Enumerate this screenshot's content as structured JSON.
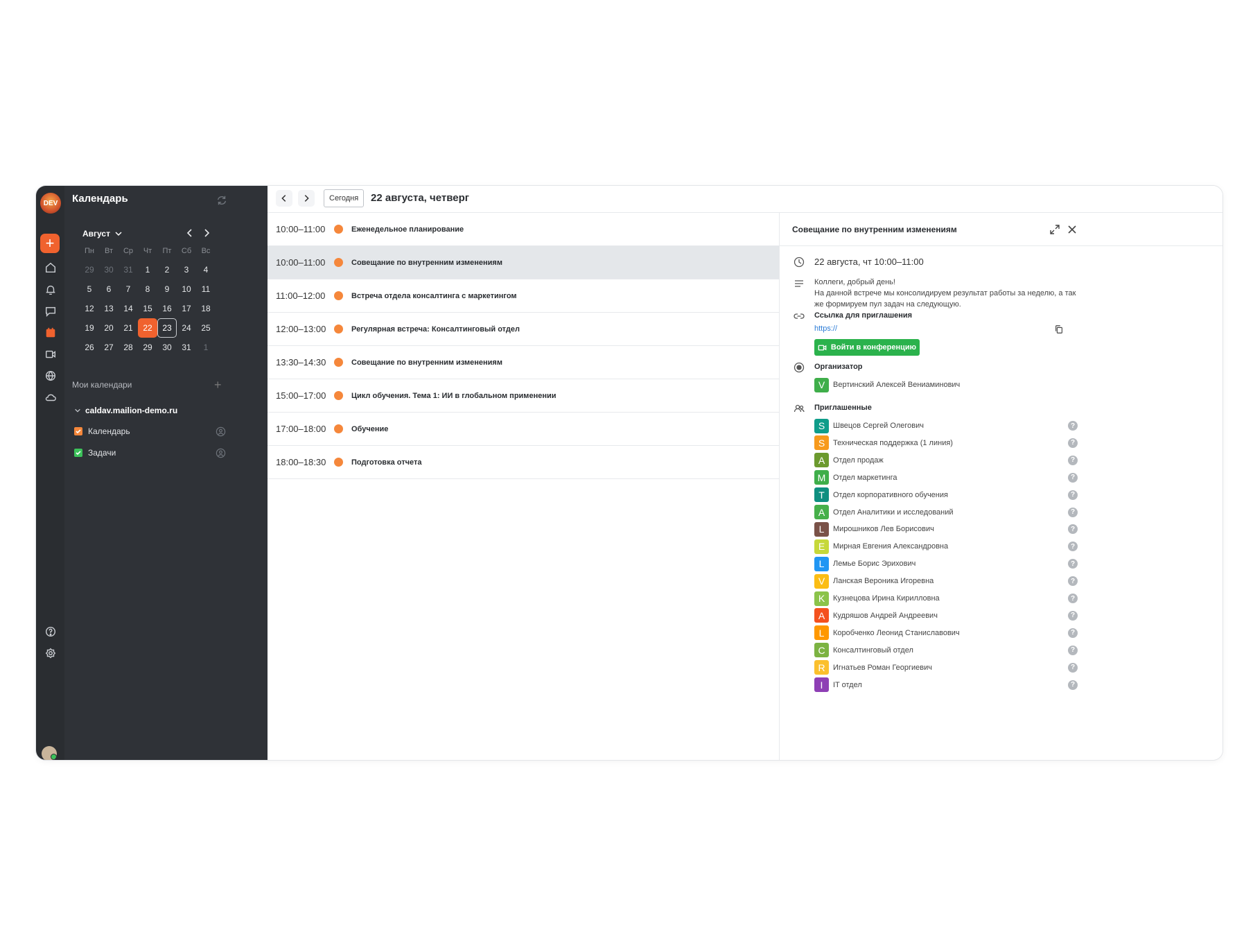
{
  "app": {
    "title": "Календарь",
    "logo_text": "DEV"
  },
  "rail": {
    "items": [
      "home-icon",
      "bell-icon",
      "chat-icon",
      "calendar-icon",
      "video-icon",
      "globe-icon",
      "cloud-icon",
      "help-icon",
      "settings-icon"
    ]
  },
  "mini_calendar": {
    "month": "Август",
    "weekdays": [
      "Пн",
      "Вт",
      "Ср",
      "Чт",
      "Пт",
      "Сб",
      "Вс"
    ],
    "weeks": [
      [
        "29",
        "30",
        "31",
        "1",
        "2",
        "3",
        "4"
      ],
      [
        "5",
        "6",
        "7",
        "8",
        "9",
        "10",
        "11"
      ],
      [
        "12",
        "13",
        "14",
        "15",
        "16",
        "17",
        "18"
      ],
      [
        "19",
        "20",
        "21",
        "22",
        "23",
        "24",
        "25"
      ],
      [
        "26",
        "27",
        "28",
        "29",
        "30",
        "31",
        "1"
      ]
    ],
    "selected": "22",
    "today": "23"
  },
  "my_calendars": {
    "label": "Мои календари",
    "account": "caldav.mailion-demo.ru",
    "items": [
      {
        "label": "Календарь",
        "color": "#f5873b"
      },
      {
        "label": "Задачи",
        "color": "#3cc25a"
      }
    ]
  },
  "toolbar": {
    "today_label": "Сегодня",
    "date_title": "22 августа, четверг"
  },
  "events": [
    {
      "time": "10:00–11:00",
      "title": "Еженедельное планирование"
    },
    {
      "time": "10:00–11:00",
      "title": "Совещание по внутренним изменениям",
      "active": true
    },
    {
      "time": "11:00–12:00",
      "title": "Встреча отдела консалтинга с маркетингом"
    },
    {
      "time": "12:00–13:00",
      "title": "Регулярная встреча: Консалтинговый отдел"
    },
    {
      "time": "13:30–14:30",
      "title": "Совещание по внутренним изменениям"
    },
    {
      "time": "15:00–17:00",
      "title": "Цикл обучения. Тема 1: ИИ в глобальном применении"
    },
    {
      "time": "17:00–18:00",
      "title": "Обучение"
    },
    {
      "time": "18:00–18:30",
      "title": "Подготовка отчета"
    }
  ],
  "event_color": "#f5873b",
  "details": {
    "title": "Совещание по внутренним изменениям",
    "datetime": "22 августа, чт 10:00–11:00",
    "description_lines": [
      "Коллеги, добрый день!",
      "На данной встрече мы консолидируем результат работы за неделю, а так же формируем пул задач на следующую."
    ],
    "invite_link_label": "Ссылка для приглашения",
    "invite_link": "https://",
    "join_button": "Войти в конференцию",
    "organizer_label": "Организатор",
    "organizer": {
      "initial": "V",
      "name": "Вертинский Алексей Вениаминович",
      "color": "#3fae4a"
    },
    "invited_label": "Приглашенные",
    "invited": [
      {
        "initial": "S",
        "name": "Швецов Сергей Олегович",
        "color": "#0f9d8a"
      },
      {
        "initial": "S",
        "name": "Техническая поддержка (1 линия)",
        "color": "#f79a1c"
      },
      {
        "initial": "A",
        "name": "Отдел продаж",
        "color": "#6c9a2e"
      },
      {
        "initial": "M",
        "name": "Отдел маркетинга",
        "color": "#3fae4a"
      },
      {
        "initial": "T",
        "name": "Отдел корпоративного обучения",
        "color": "#0f8f80"
      },
      {
        "initial": "A",
        "name": "Отдел Аналитики и исследований",
        "color": "#46b04a"
      },
      {
        "initial": "L",
        "name": "Мирошников Лев Борисович",
        "color": "#7a5248"
      },
      {
        "initial": "E",
        "name": "Мирная Евгения Александровна",
        "color": "#c6d83a"
      },
      {
        "initial": "L",
        "name": "Лемье Борис Эрихович",
        "color": "#2196f3"
      },
      {
        "initial": "V",
        "name": "Ланская Вероника Игоревна",
        "color": "#fbbd14"
      },
      {
        "initial": "K",
        "name": "Кузнецова Ирина Кирилловна",
        "color": "#8bc34a"
      },
      {
        "initial": "A",
        "name": "Кудряшов Андрей Андреевич",
        "color": "#f4511e"
      },
      {
        "initial": "L",
        "name": "Коробченко Леонид Станиславович",
        "color": "#ff9800"
      },
      {
        "initial": "C",
        "name": "Консалтинговый отдел",
        "color": "#7cb342"
      },
      {
        "initial": "R",
        "name": "Игнатьев Роман Георгиевич",
        "color": "#fbc02d"
      },
      {
        "initial": "I",
        "name": "IT отдел",
        "color": "#8e3fb5"
      }
    ],
    "status_mark": "?"
  }
}
